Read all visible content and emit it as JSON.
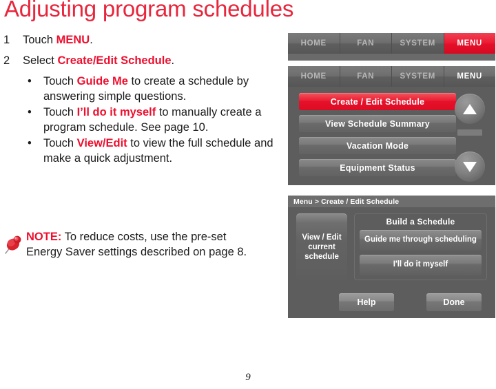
{
  "document": {
    "title": "Adjusting program schedules",
    "page_number": "9",
    "title_color": "#e8263c",
    "highlight_color": "#ee0f2e"
  },
  "steps": [
    {
      "number": "1",
      "parts": [
        {
          "text": "Touch ",
          "style": "normal"
        },
        {
          "text": "MENU",
          "style": "highlight"
        },
        {
          "text": ".",
          "style": "normal"
        }
      ]
    },
    {
      "number": "2",
      "parts": [
        {
          "text": "Select ",
          "style": "normal"
        },
        {
          "text": "Create/Edit Schedule",
          "style": "highlight"
        },
        {
          "text": ".",
          "style": "normal"
        }
      ]
    }
  ],
  "bullets": [
    {
      "marker": "•",
      "parts": [
        {
          "text": "Touch ",
          "style": "normal"
        },
        {
          "text": "Guide Me",
          "style": "highlight"
        },
        {
          "text": " to create a schedule by answering simple questions.",
          "style": "normal"
        }
      ]
    },
    {
      "marker": "•",
      "parts": [
        {
          "text": "Touch ",
          "style": "normal"
        },
        {
          "text": "I’ll do it myself",
          "style": "highlight"
        },
        {
          "text": " to manually create a program schedule. See page 10.",
          "style": "normal"
        }
      ]
    },
    {
      "marker": "•",
      "parts": [
        {
          "text": "Touch ",
          "style": "normal"
        },
        {
          "text": "View/Edit",
          "style": "highlight"
        },
        {
          "text": " to view the full schedule and make a quick adjustment.",
          "style": "normal"
        }
      ]
    }
  ],
  "note": {
    "icon": "pushpin-icon",
    "label": "NOTE:",
    "text": " To reduce costs, use the pre-set Energy Saver settings described on page 8."
  },
  "panel_menubar": {
    "tabs": [
      {
        "label": "HOME",
        "state": "inactive"
      },
      {
        "label": "FAN",
        "state": "inactive"
      },
      {
        "label": "SYSTEM",
        "state": "inactive"
      },
      {
        "label": "MENU",
        "state": "selected-red"
      }
    ]
  },
  "panel_menu": {
    "tabs": [
      {
        "label": "HOME",
        "state": "inactive"
      },
      {
        "label": "FAN",
        "state": "inactive"
      },
      {
        "label": "SYSTEM",
        "state": "inactive"
      },
      {
        "label": "MENU",
        "state": "active"
      }
    ],
    "items": [
      {
        "label": "Create / Edit Schedule",
        "selected": true
      },
      {
        "label": "View Schedule Summary",
        "selected": false
      },
      {
        "label": "Vacation Mode",
        "selected": false
      },
      {
        "label": "Equipment Status",
        "selected": false
      }
    ],
    "scroll_up": "up-arrow-icon",
    "scroll_down": "down-arrow-icon"
  },
  "panel_schedule": {
    "breadcrumb": "Menu > Create / Edit Schedule",
    "view_edit_button": "View / Edit current schedule",
    "build_group_title": "Build a Schedule",
    "build_buttons": [
      {
        "label": "Guide me through scheduling"
      },
      {
        "label": "I'll do it myself"
      }
    ],
    "help_button": "Help",
    "done_button": "Done"
  }
}
